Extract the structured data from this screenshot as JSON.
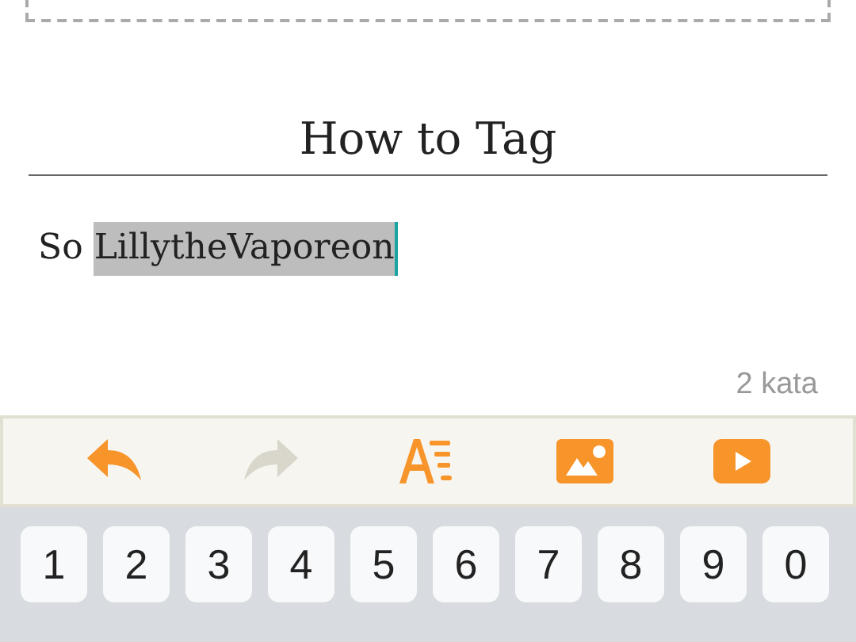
{
  "editor": {
    "title": "How to Tag",
    "body": [
      {
        "text": "So ",
        "selected": false
      },
      {
        "text": "LillytheVaporeon",
        "selected": true
      }
    ],
    "word_count": "2 kata"
  },
  "toolbar": [
    {
      "kind": "undo",
      "disabled": false
    },
    {
      "kind": "redo",
      "disabled": true
    },
    {
      "kind": "format",
      "disabled": false
    },
    {
      "kind": "image",
      "disabled": false
    },
    {
      "kind": "video",
      "disabled": false
    }
  ],
  "keyboard": {
    "keys": [
      "1",
      "2",
      "3",
      "4",
      "5",
      "6",
      "7",
      "8",
      "9",
      "0"
    ]
  }
}
